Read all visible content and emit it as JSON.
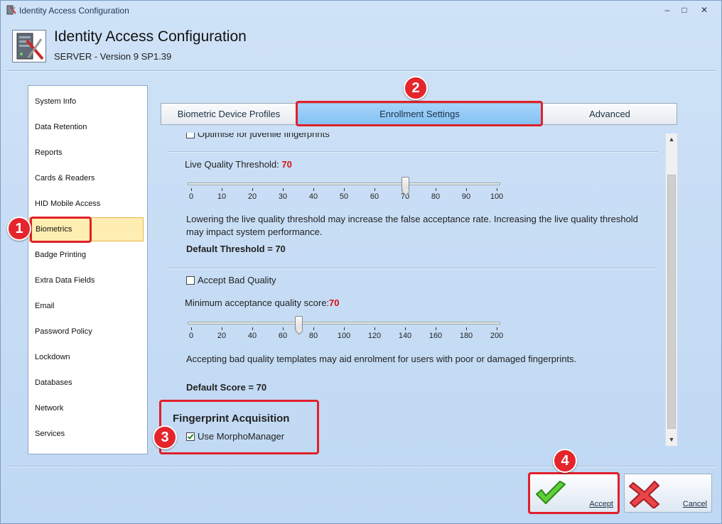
{
  "window": {
    "title": "Identity Access Configuration",
    "controls": {
      "minimize": "–",
      "maximize": "□",
      "close": "✕"
    }
  },
  "header": {
    "title": "Identity Access Configuration",
    "subtitle": "SERVER - Version 9 SP1.39",
    "icon": "server-tools-icon"
  },
  "sidebar": {
    "items": [
      {
        "label": "System Info"
      },
      {
        "label": "Data Retention"
      },
      {
        "label": "Reports"
      },
      {
        "label": "Cards & Readers"
      },
      {
        "label": "HID Mobile Access"
      },
      {
        "label": "Biometrics",
        "selected": true
      },
      {
        "label": "Badge Printing"
      },
      {
        "label": "Extra Data Fields"
      },
      {
        "label": "Email"
      },
      {
        "label": "Password Policy"
      },
      {
        "label": "Lockdown"
      },
      {
        "label": "Databases"
      },
      {
        "label": "Network"
      },
      {
        "label": "Services"
      }
    ]
  },
  "tabs": [
    {
      "label": "Biometric Device Profiles"
    },
    {
      "label": "Enrollment Settings",
      "selected": true
    },
    {
      "label": "Advanced"
    }
  ],
  "enrollment": {
    "juvenile_label": "Optimise for juvenile fingerprints",
    "live_quality": {
      "label": "Live Quality Threshold:",
      "value": "70",
      "slider_value": 70,
      "slider_min": 0,
      "slider_max": 100,
      "ticks": [
        "0",
        "10",
        "20",
        "30",
        "40",
        "50",
        "60",
        "70",
        "80",
        "90",
        "100"
      ],
      "description": "Lowering the live quality threshold may increase the false acceptance rate. Increasing the live quality threshold may impact system performance.",
      "default_text": "Default Threshold = 70"
    },
    "bad_quality": {
      "checkbox_label": "Accept Bad Quality",
      "checked": false,
      "min_label": "Minimum  acceptance quality  score:",
      "min_value": "70",
      "slider_value": 70,
      "slider_min": 0,
      "slider_max": 200,
      "ticks": [
        "0",
        "20",
        "40",
        "60",
        "80",
        "100",
        "120",
        "140",
        "160",
        "180",
        "200"
      ],
      "description": "Accepting bad quality templates may aid enrolment for users with poor or damaged fingerprints.",
      "default_text": "Default Score = 70"
    },
    "acquisition": {
      "heading": "Fingerprint Acquisition",
      "checkbox_label": "Use MorphoManager",
      "checked": true
    }
  },
  "callouts": [
    "1",
    "2",
    "3",
    "4"
  ],
  "buttons": {
    "accept": "Accept",
    "cancel": "Cancel"
  },
  "colors": {
    "accent_red": "#e0202a",
    "value_red": "#d61010",
    "tab_selected": "#8fc8f5",
    "sidebar_selected": "#ffeeb1"
  }
}
